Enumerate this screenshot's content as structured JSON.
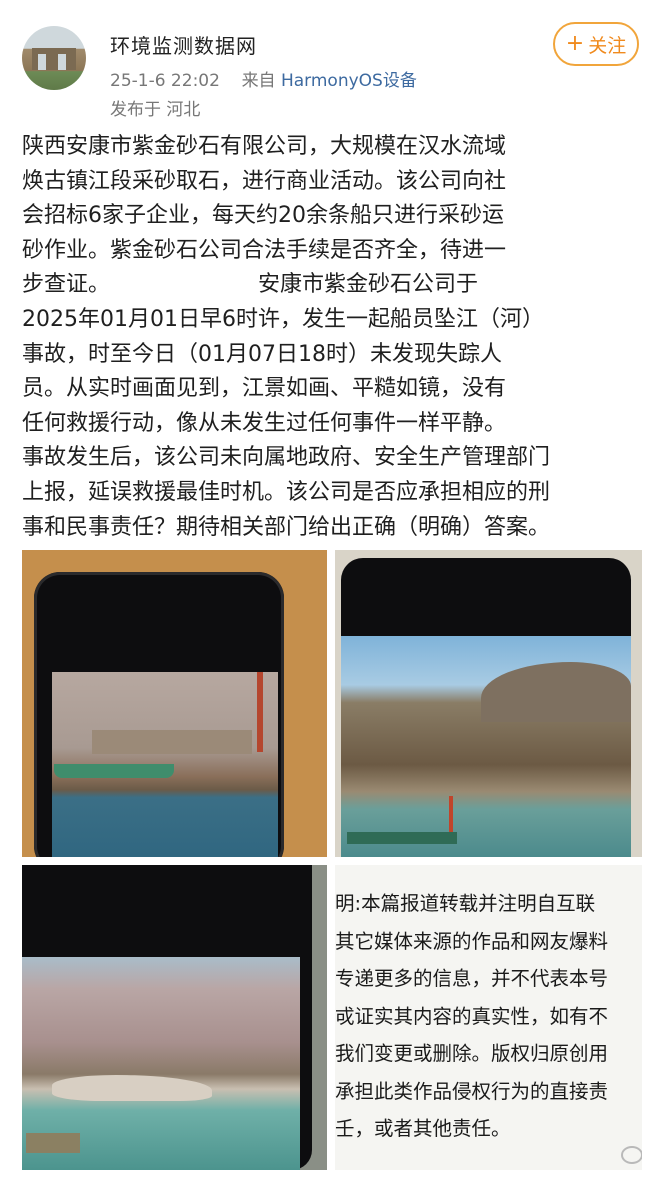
{
  "author": {
    "name": "环境监测数据网",
    "timestamp": "25-1-6 22:02",
    "source_prefix": "来自",
    "source_device": "HarmonyOS设备",
    "location": "发布于 河北",
    "follow_label": "关注",
    "follow_icon": "+"
  },
  "post": {
    "lines": [
      "陕西安康市紫金砂石有限公司，大规模在汉水流域",
      "焕古镇江段采砂取石，进行商业活动。该公司向社",
      "会招标6家子企业，每天约20余条船只进行采砂运",
      "砂作业。紫金砂石公司合法手续是否齐全，待进一",
      "步查证。",
      "安康市紫金砂石公司于",
      "2025年01月01日早6时许，发生一起船员坠江（河）",
      "事故，时至今日（01月07日18时）未发现失踪人",
      "员。从实时画面见到，江景如画、平糙如镜，没有",
      "任何救援行动，像从未发生过任何事件一样平静。",
      "事故发生后，该公司未向属地政府、安全生产管理部门",
      "上报，延误救援最佳时机。该公司是否应承担相应的刑",
      "事和民事责任？期待相关部门给出正确（明确）答案。"
    ]
  },
  "images": {
    "disclaimer_lines": [
      "明:本篇报道转载并注明自互联",
      "其它媒体来源的作品和网友爆料",
      "专递更多的信息，并不代表本号",
      "戓证实其内容的真实性，如有不",
      "我们变更或删除。版权归原创用",
      "承担此类作品侵权行为的直接责",
      "壬，或者其他责任。"
    ]
  },
  "colors": {
    "follow_accent": "#f08a1d",
    "device_link": "#3d6aa0",
    "meta_gray": "#777777"
  }
}
